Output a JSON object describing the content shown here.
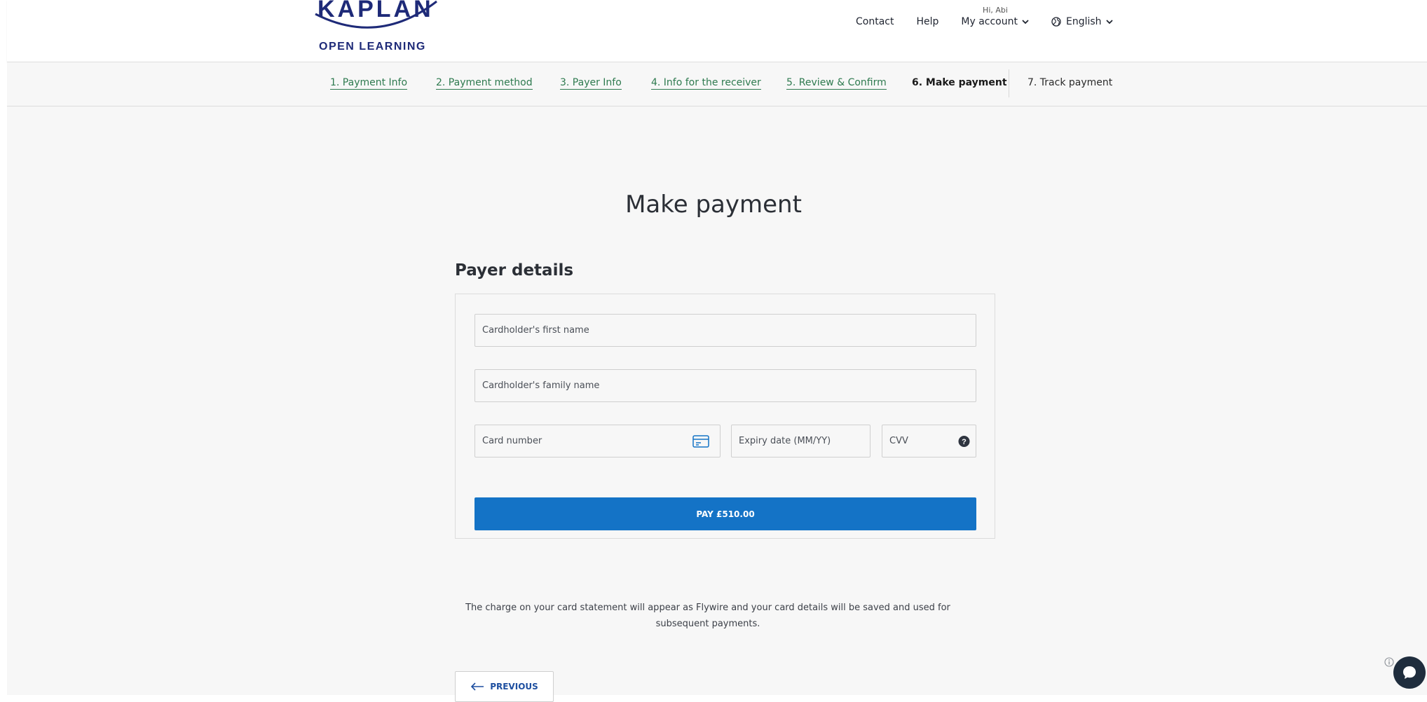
{
  "header": {
    "logo": {
      "wordmark": "KAPLAN",
      "subtitle": "OPEN LEARNING"
    },
    "greeting": "Hi, Abi",
    "nav": {
      "contact": "Contact",
      "help": "Help",
      "my_account": "My account",
      "language": "English"
    }
  },
  "steps": [
    {
      "label": "1. Payment Info",
      "state": "done"
    },
    {
      "label": "2. Payment method",
      "state": "done"
    },
    {
      "label": "3. Payer Info",
      "state": "done"
    },
    {
      "label": "4. Info for the receiver",
      "state": "done"
    },
    {
      "label": "5. Review & Confirm",
      "state": "done"
    },
    {
      "label": "6. Make payment",
      "state": "current"
    },
    {
      "label": "7. Track payment",
      "state": "upcoming"
    }
  ],
  "main": {
    "title": "Make payment",
    "section_title": "Payer details",
    "form": {
      "first_name": {
        "placeholder": "Cardholder's first name",
        "value": ""
      },
      "family_name": {
        "placeholder": "Cardholder's family name",
        "value": ""
      },
      "card_number": {
        "placeholder": "Card number",
        "value": "",
        "icon": "credit-card-icon"
      },
      "expiry": {
        "placeholder": "Expiry date (MM/YY)",
        "value": ""
      },
      "cvv": {
        "placeholder": "CVV",
        "value": "",
        "icon": "help-icon"
      }
    },
    "pay_button": "PAY £510.00",
    "disclaimer_line1": "The charge on your card statement will appear as Flywire and your card details will be saved and used for",
    "disclaimer_line2": "subsequent payments.",
    "previous_button": "PREVIOUS"
  },
  "colors": {
    "brand_navy": "#1e2a78",
    "step_done": "#2e7a4f",
    "primary_button": "#1473c6",
    "chat_bubble": "#1f2d3d"
  }
}
